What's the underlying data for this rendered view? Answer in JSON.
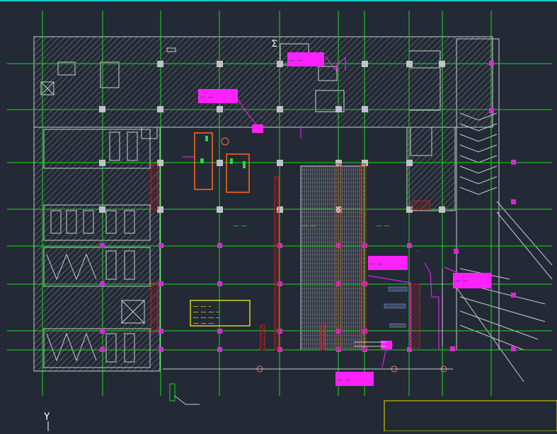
{
  "colors": {
    "background": "#232a35",
    "grid_axis": "#19d919",
    "hatch": "#8a8f96",
    "wall": "#c9ccd0",
    "column_marker": "#d52ad5",
    "column_box": "#bfc3c8",
    "red_hatch": "#c21e1e",
    "annotation": "#ff22ff",
    "equipment_outline": "#ff6a1a",
    "note_border": "#ffff00",
    "note_text": "#ffff00",
    "green_label": "#37ff37",
    "frame_top": "#1ec8c8",
    "title_frame": "#e0e000"
  },
  "note": {
    "lines": [
      "…… …… …",
      "…… …… …… …",
      "…… …… …… …",
      "…… …… ……"
    ]
  },
  "annotations": {
    "tag_top_right": "…… ……",
    "tag_left_mid": "…… ……",
    "tag_center": "…… ……",
    "tag_right_mid": "…… ……",
    "tag_bottom": "…… ……",
    "label_upper": "…",
    "label_mid_left": "…",
    "label_mid_center": "…"
  },
  "green_labels": [
    "…… ……",
    "…… ……",
    "…… ……"
  ],
  "axis_symbols": {
    "top_mark": "Σ",
    "y_axis": "Y"
  }
}
